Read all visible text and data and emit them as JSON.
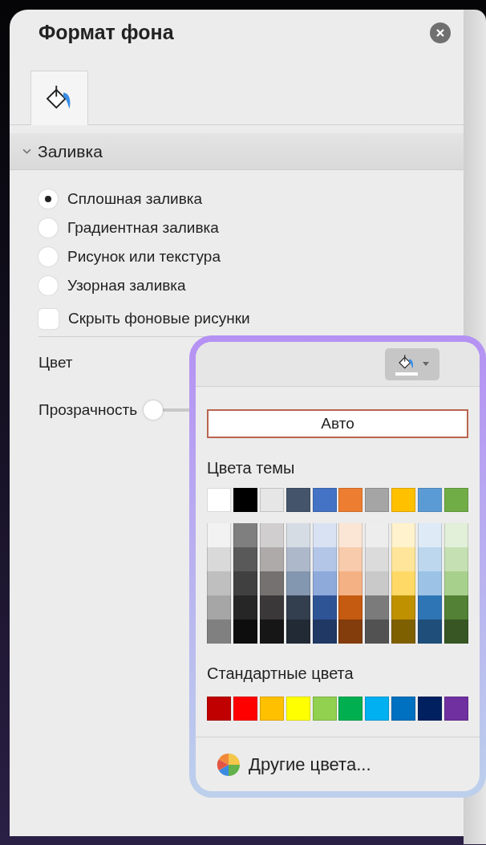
{
  "pane": {
    "title": "Формат фона"
  },
  "tabs": [
    {
      "selected": true
    }
  ],
  "section": {
    "title": "Заливка",
    "expanded": true
  },
  "fill_options": [
    {
      "label": "Сплошная заливка",
      "selected": true
    },
    {
      "label": "Градиентная заливка",
      "selected": false
    },
    {
      "label": "Рисунок или текстура",
      "selected": false
    },
    {
      "label": "Узорная заливка",
      "selected": false
    }
  ],
  "hide_background": {
    "label": "Скрыть фоновые рисунки",
    "checked": false
  },
  "color_label": "Цвет",
  "transparency": {
    "label": "Прозрачность",
    "level": 0
  },
  "color_menu": {
    "auto": "Авто",
    "theme_title": "Цвета темы",
    "theme_colors": [
      {
        "color": "#ffffff"
      },
      {
        "color": "#000000"
      },
      {
        "color": "#e7e6e6"
      },
      {
        "color": "#44546a"
      },
      {
        "color": "#4472c4"
      },
      {
        "color": "#ed7d31"
      },
      {
        "color": "#a5a5a5"
      },
      {
        "color": "#ffc000"
      },
      {
        "color": "#5b9bd5"
      },
      {
        "color": "#70ad47"
      }
    ],
    "shade_columns": [
      {
        "shades": [
          {
            "color": "#f2f2f2"
          },
          {
            "color": "#d9d9d9"
          },
          {
            "color": "#bfbfbf"
          },
          {
            "color": "#a6a6a6"
          },
          {
            "color": "#808080"
          }
        ]
      },
      {
        "shades": [
          {
            "color": "#7f7f7f"
          },
          {
            "color": "#595959"
          },
          {
            "color": "#404040"
          },
          {
            "color": "#262626"
          },
          {
            "color": "#0d0d0d"
          }
        ]
      },
      {
        "shades": [
          {
            "color": "#d0cece"
          },
          {
            "color": "#aeaaaa"
          },
          {
            "color": "#757171"
          },
          {
            "color": "#3a3838"
          },
          {
            "color": "#171616"
          }
        ]
      },
      {
        "shades": [
          {
            "color": "#d6dce4"
          },
          {
            "color": "#adb9ca"
          },
          {
            "color": "#8497b0"
          },
          {
            "color": "#333f4f"
          },
          {
            "color": "#222a35"
          }
        ]
      },
      {
        "shades": [
          {
            "color": "#d9e2f3"
          },
          {
            "color": "#b4c6e7"
          },
          {
            "color": "#8eaadb"
          },
          {
            "color": "#2f5496"
          },
          {
            "color": "#1f3864"
          }
        ]
      },
      {
        "shades": [
          {
            "color": "#fbe5d5"
          },
          {
            "color": "#f7cbac"
          },
          {
            "color": "#f4b183"
          },
          {
            "color": "#c55a11"
          },
          {
            "color": "#833c0b"
          }
        ]
      },
      {
        "shades": [
          {
            "color": "#ededed"
          },
          {
            "color": "#dbdbdb"
          },
          {
            "color": "#c9c9c9"
          },
          {
            "color": "#7b7b7b"
          },
          {
            "color": "#525252"
          }
        ]
      },
      {
        "shades": [
          {
            "color": "#fff2cc"
          },
          {
            "color": "#fee599"
          },
          {
            "color": "#ffd965"
          },
          {
            "color": "#bf9000"
          },
          {
            "color": "#7f6000"
          }
        ]
      },
      {
        "shades": [
          {
            "color": "#deeaf6"
          },
          {
            "color": "#bdd7ee"
          },
          {
            "color": "#9cc3e5"
          },
          {
            "color": "#2e75b5"
          },
          {
            "color": "#1e4e79"
          }
        ]
      },
      {
        "shades": [
          {
            "color": "#e2efd9"
          },
          {
            "color": "#c5e0b3"
          },
          {
            "color": "#a8d08d"
          },
          {
            "color": "#538135"
          },
          {
            "color": "#375623"
          }
        ]
      }
    ],
    "standard_title": "Стандартные цвета",
    "standard_colors": [
      {
        "color": "#c00000"
      },
      {
        "color": "#ff0000"
      },
      {
        "color": "#ffc000"
      },
      {
        "color": "#ffff00"
      },
      {
        "color": "#92d050"
      },
      {
        "color": "#00b050"
      },
      {
        "color": "#00b0f0"
      },
      {
        "color": "#0070c0"
      },
      {
        "color": "#002060"
      },
      {
        "color": "#7030a0"
      }
    ],
    "more": "Другие цвета..."
  }
}
